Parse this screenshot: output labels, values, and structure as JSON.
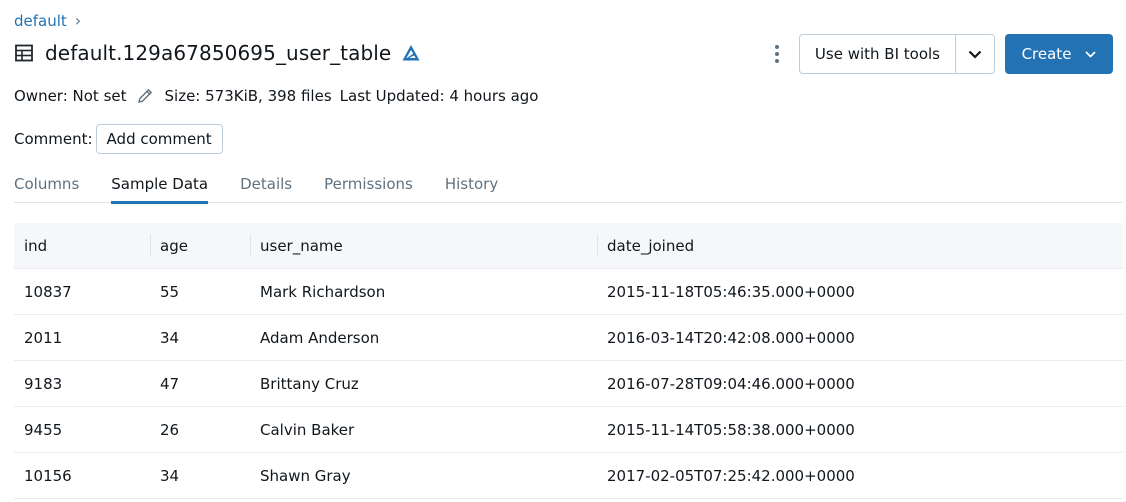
{
  "breadcrumb": {
    "catalog": "default",
    "separator": "›"
  },
  "header": {
    "title": "default.129a67850695_user_table"
  },
  "actions": {
    "bi_tools_label": "Use with BI tools",
    "create_label": "Create"
  },
  "meta": {
    "owner": "Owner: Not set",
    "size": "Size: 573KiB, 398 files",
    "last_updated": "Last Updated: 4 hours ago"
  },
  "comment": {
    "label": "Comment:",
    "button": "Add comment"
  },
  "tabs": [
    {
      "label": "Columns",
      "active": false
    },
    {
      "label": "Sample Data",
      "active": true
    },
    {
      "label": "Details",
      "active": false
    },
    {
      "label": "Permissions",
      "active": false
    },
    {
      "label": "History",
      "active": false
    }
  ],
  "table": {
    "columns": [
      "ind",
      "age",
      "user_name",
      "date_joined"
    ],
    "rows": [
      [
        "10837",
        "55",
        "Mark Richardson",
        "2015-11-18T05:46:35.000+0000"
      ],
      [
        "2011",
        "34",
        "Adam Anderson",
        "2016-03-14T20:42:08.000+0000"
      ],
      [
        "9183",
        "47",
        "Brittany Cruz",
        "2016-07-28T09:04:46.000+0000"
      ],
      [
        "9455",
        "26",
        "Calvin Baker",
        "2015-11-14T05:58:38.000+0000"
      ],
      [
        "10156",
        "34",
        "Shawn Gray",
        "2017-02-05T07:25:42.000+0000"
      ]
    ]
  },
  "colors": {
    "accent": "#2272b4",
    "text": "#11171c",
    "muted": "#5f7281",
    "border": "#c0cdd8",
    "delta": "#2272b4"
  },
  "icons": [
    "chevron-right-icon",
    "table-icon",
    "delta-icon",
    "kebab-icon",
    "chevron-down-icon",
    "pencil-icon"
  ]
}
